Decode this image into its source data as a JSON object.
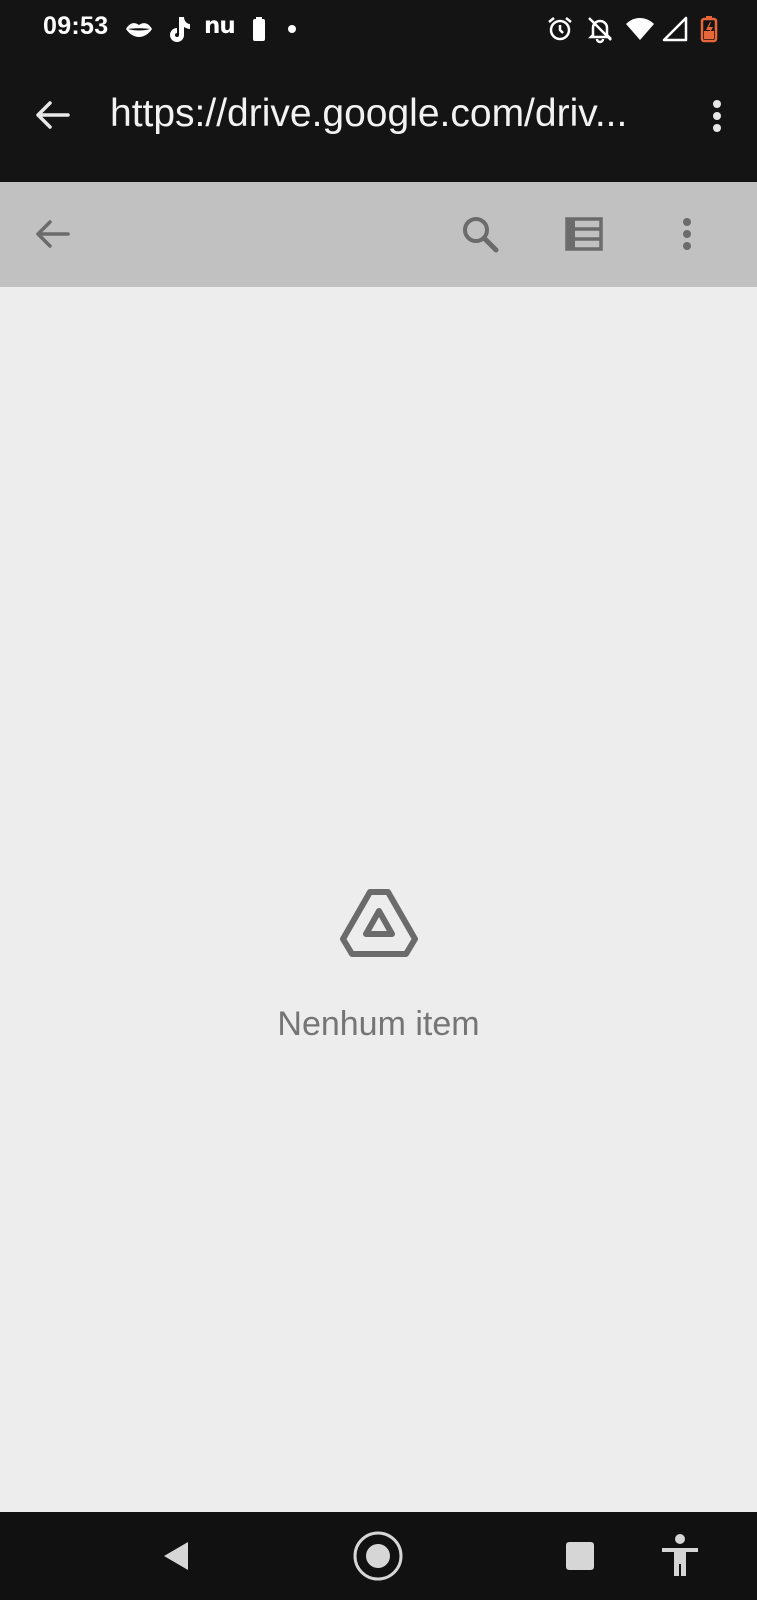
{
  "status_bar": {
    "time": "09:53",
    "carrier_badge": "nu",
    "left_icons": [
      "lips-icon",
      "tiktok-icon",
      "nu-icon",
      "battery-saver-icon",
      "dot-icon"
    ],
    "right_icons": [
      "alarm-icon",
      "notifications-off-icon",
      "wifi-icon",
      "signal-icon",
      "battery-icon"
    ],
    "battery_color": "#e8673a"
  },
  "url_bar": {
    "url": "https://drive.google.com/driv...",
    "back_icon": "arrow-back-icon",
    "menu_icon": "more-vert-icon"
  },
  "toolbar": {
    "back_icon": "arrow-back-icon",
    "search_icon": "search-icon",
    "view_icon": "list-view-icon",
    "menu_icon": "more-vert-icon"
  },
  "main": {
    "empty_icon": "drive-logo-icon",
    "empty_message": "Nenhum item"
  },
  "nav_bar": {
    "icons": [
      "nav-back-icon",
      "nav-home-icon",
      "nav-recents-icon",
      "accessibility-icon"
    ]
  },
  "colors": {
    "status_bar_bg": "#141414",
    "toolbar_bg": "#c1c1c1",
    "content_bg": "#ededed",
    "icon_gray": "#6b6b6b",
    "empty_text": "#757575"
  }
}
